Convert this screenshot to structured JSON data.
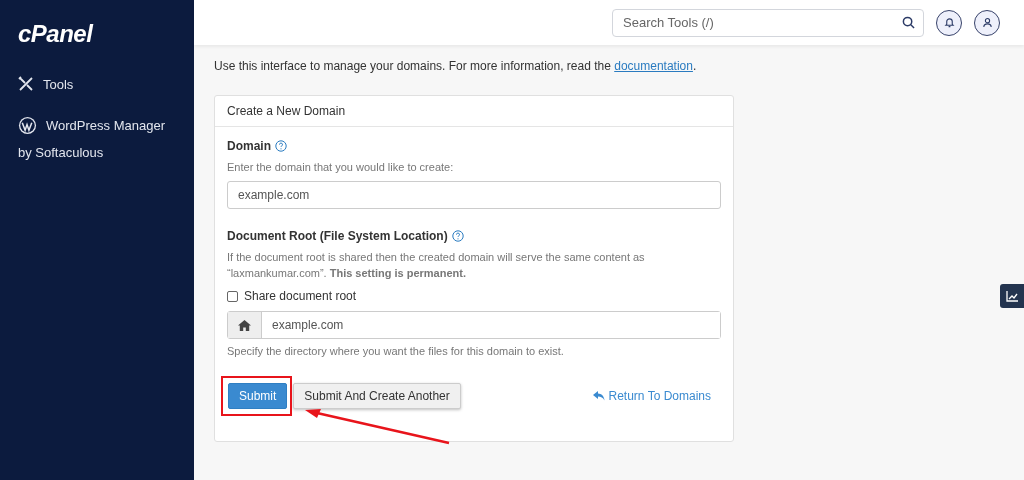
{
  "sidebar": {
    "logo": "cPanel",
    "items": [
      {
        "kind": "tools",
        "label": "Tools"
      },
      {
        "kind": "wordpress",
        "label": "WordPress Manager",
        "sublabel": "by Softaculous"
      }
    ]
  },
  "header": {
    "search": {
      "placeholder": "Search Tools (/)"
    }
  },
  "intro": {
    "text": "Use this interface to manage your domains. For more information, read the",
    "link": "documentation",
    "end": "."
  },
  "card": {
    "title": "Create a New Domain",
    "domain": {
      "label": "Domain",
      "hint": "Enter the domain that you would like to create:",
      "placeholder": "example.com"
    },
    "docroot": {
      "label": "Document Root (File System Location)",
      "hint": "If the document root is shared then the created domain will serve the same content as “laxmankumar.com”. **This setting is permanent.**",
      "share": {
        "label": "Share document root",
        "checked": false
      },
      "placeholder": "example.com",
      "help": "Specify the directory where you want the files for this domain to exist."
    },
    "buttons": [
      {
        "kind": "primary",
        "label": "Submit"
      },
      {
        "kind": "secondary",
        "label": "Submit And Create Another"
      }
    ],
    "return_link": "Return To Domains"
  }
}
